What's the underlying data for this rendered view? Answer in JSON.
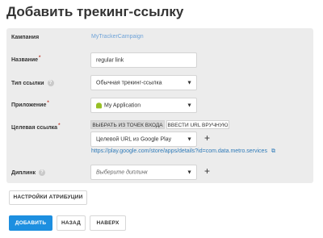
{
  "page": {
    "title": "Добавить трекинг-ссылку"
  },
  "form": {
    "campaign": {
      "label": "Кампания",
      "value": "MyTrackerCampaign"
    },
    "name": {
      "label": "Название",
      "required": "*",
      "value": "regular link"
    },
    "link_type": {
      "label": "Тип ссылки",
      "help": "?",
      "value": "Обычная трекинг-ссылка"
    },
    "app": {
      "label": "Приложение",
      "required": "*",
      "value": "My Application"
    },
    "target": {
      "label": "Целевая ссылка",
      "required": "*",
      "tabs": [
        "ВЫБРАТЬ ИЗ ТОЧЕК ВХОДА",
        "ВВЕСТИ URL ВРУЧНУЮ"
      ],
      "value": "Целевой URL из Google Play",
      "url": "https://play.google.com/store/apps/details?id=com.data.metro.services"
    },
    "deeplink": {
      "label": "Диплинк",
      "help": "?",
      "placeholder": "Выберите диплинк"
    }
  },
  "icons": {
    "caret": "▼",
    "plus": "+",
    "external": "⧉"
  },
  "buttons": {
    "attribution": "НАСТРОЙКИ АТРИБУЦИИ",
    "add": "ДОБАВИТЬ",
    "back": "НАЗАД",
    "top": "НАВЕРХ"
  },
  "colors": {
    "primary": "#1d8fe0",
    "link": "#2e7ab8",
    "panel": "#ececec"
  }
}
